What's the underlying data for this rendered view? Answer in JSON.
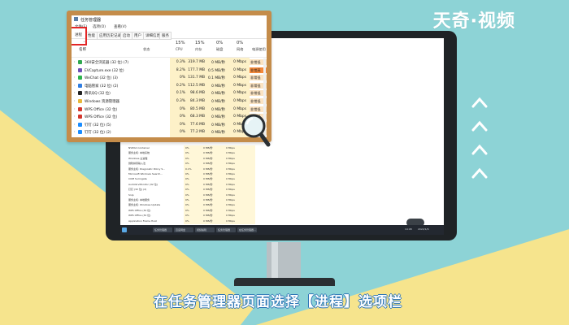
{
  "brand": "天奇·视频",
  "caption": "在任务管理器页面选择【进程】选项栏",
  "colors": {
    "background": "#8dd3d6",
    "accent_yellow": "#f6e48d",
    "frame": "#c48c4a",
    "highlight_red": "#e32626",
    "power_high": "#f4893b",
    "power_low": "#fbe3c2"
  },
  "window": {
    "title": "任务管理器",
    "menu": [
      "文件(F)",
      "选项(O)",
      "查看(V)"
    ],
    "tabs": [
      "进程",
      "性能",
      "应用历史记录",
      "启动",
      "用户",
      "详细信息",
      "服务"
    ],
    "header": {
      "cpu_pct": "15%",
      "mem_pct": "15%",
      "disk_pct": "0%",
      "net_pct": "0%",
      "name": "名称",
      "status": "状态",
      "cpu": "CPU",
      "memory": "内存",
      "disk": "磁盘",
      "network": "网络",
      "power": "电源使用"
    },
    "rows": [
      {
        "name": "360安全浏览器 (32 位) (7)",
        "cpu": "0.3%",
        "mem": "319.7 MB",
        "disk": "0 MB/秒",
        "net": "0 Mbps",
        "power": "非常低",
        "icon": "browser-360-icon",
        "icon_color": "#2fa84f",
        "expand": "›"
      },
      {
        "name": "EVCapture.exe (32 位)",
        "cpu": "8.2%",
        "mem": "177.7 MB",
        "disk": "0.5 MB/秒",
        "net": "0 Mbps",
        "power": "非常高",
        "icon": "capture-icon",
        "icon_color": "#6d4fb5",
        "expand": ""
      },
      {
        "name": "WeChat (32 位) (3)",
        "cpu": "0%",
        "mem": "131.7 MB",
        "disk": "0.1 MB/秒",
        "net": "0 Mbps",
        "power": "非常低",
        "icon": "wechat-icon",
        "icon_color": "#2bb24c",
        "expand": "›"
      },
      {
        "name": "电脑管家 (32 位) (2)",
        "cpu": "0.2%",
        "mem": "112.5 MB",
        "disk": "0 MB/秒",
        "net": "0 Mbps",
        "power": "非常低",
        "icon": "pc-manager-icon",
        "icon_color": "#2f7de1",
        "expand": "›"
      },
      {
        "name": "腾讯QQ (32 位)",
        "cpu": "0.1%",
        "mem": "98.6 MB",
        "disk": "0 MB/秒",
        "net": "0 Mbps",
        "power": "非常低",
        "icon": "qq-icon",
        "icon_color": "#222222",
        "expand": "›"
      },
      {
        "name": "Windows 资源管理器",
        "cpu": "0.3%",
        "mem": "84.3 MB",
        "disk": "0 MB/秒",
        "net": "0 Mbps",
        "power": "非常低",
        "icon": "folder-icon",
        "icon_color": "#e8b83b",
        "expand": "›"
      },
      {
        "name": "WPS Office (32 位)",
        "cpu": "0%",
        "mem": "80.5 MB",
        "disk": "0 MB/秒",
        "net": "0 Mbps",
        "power": "非常低",
        "icon": "wps-icon",
        "icon_color": "#d3362c",
        "expand": "›"
      },
      {
        "name": "WPS Office (32 位)",
        "cpu": "0%",
        "mem": "68.3 MB",
        "disk": "0 MB/秒",
        "net": "0 Mbps",
        "power": "非常低",
        "icon": "wps-icon",
        "icon_color": "#d3362c",
        "expand": "›"
      },
      {
        "name": "钉钉 (32 位) (5)",
        "cpu": "0%",
        "mem": "77.6 MB",
        "disk": "0 MB/秒",
        "net": "0 Mbps",
        "power": "非常低",
        "icon": "dingtalk-icon",
        "icon_color": "#1a8cff",
        "expand": "›"
      },
      {
        "name": "钉钉 (32 位) (2)",
        "cpu": "0%",
        "mem": "77.2 MB",
        "disk": "0 MB/秒",
        "net": "0 Mbps",
        "power": "非常低",
        "icon": "dingtalk-icon",
        "icon_color": "#1a8cff",
        "expand": "›"
      }
    ]
  },
  "screen_rows": [
    {
      "name": "NVIDIA Container",
      "cpu": "0%",
      "mem": "0 MB/秒",
      "net": "0 Mbps"
    },
    {
      "name": "服务主机: 本地系统",
      "cpu": "0%",
      "mem": "0 MB/秒",
      "net": "0 Mbps"
    },
    {
      "name": "Windows 主进程",
      "cpu": "0%",
      "mem": "0 MB/秒",
      "net": "0 Mbps"
    },
    {
      "name": "微软拼音输入法",
      "cpu": "0%",
      "mem": "0 MB/秒",
      "net": "0 Mbps"
    },
    {
      "name": "服务主机: Diagnostic Policy S...",
      "cpu": "0.1%",
      "mem": "0 MB/秒",
      "net": "0 Mbps"
    },
    {
      "name": "Microsoft Windows Search...",
      "cpu": "0%",
      "mem": "0 MB/秒",
      "net": "0 Mbps"
    },
    {
      "name": "COM Surrogate",
      "cpu": "0%",
      "mem": "0 MB/秒",
      "net": "0 Mbps"
    },
    {
      "name": "AudioSrvMonitor (32 位)",
      "cpu": "0%",
      "mem": "0 MB/秒",
      "net": "0 Mbps"
    },
    {
      "name": "钉钉 (32 位) (2)",
      "cpu": "0%",
      "mem": "0 MB/秒",
      "net": "0 Mbps"
    },
    {
      "name": "Snip",
      "cpu": "0%",
      "mem": "0 MB/秒",
      "net": "0 Mbps"
    },
    {
      "name": "服务主机: 本地服务",
      "cpu": "0%",
      "mem": "0 MB/秒",
      "net": "0 Mbps"
    },
    {
      "name": "服务主机: Windows Update",
      "cpu": "0%",
      "mem": "0 MB/秒",
      "net": "0 Mbps"
    },
    {
      "name": "WPS Office (32 位)",
      "cpu": "0%",
      "mem": "0 MB/秒",
      "net": "0 Mbps"
    },
    {
      "name": "WPS Office (32 位)",
      "cpu": "0%",
      "mem": "0 MB/秒",
      "net": "0 Mbps"
    },
    {
      "name": "Application Frame Host",
      "cpu": "0%",
      "mem": "0 MB/秒",
      "net": "0 Mbps"
    }
  ],
  "taskbar": {
    "items": [
      "任务管理器",
      "百度网盘",
      "视频编辑",
      "任务管理器",
      "在任务管理器..."
    ],
    "time": "14:08",
    "date": "2022/1/6"
  }
}
